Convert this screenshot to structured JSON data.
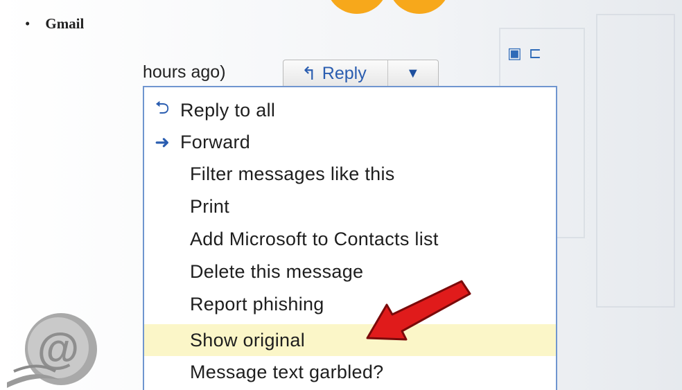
{
  "slide": {
    "bullet": "•",
    "heading": "Gmail"
  },
  "header": {
    "hours_text": "hours ago)",
    "reply_label": "Reply",
    "dropdown_glyph": "▼"
  },
  "menu": {
    "items": [
      {
        "label": "Reply to all",
        "icon": "reply-all-icon"
      },
      {
        "label": "Forward",
        "icon": "forward-arrow-icon"
      },
      {
        "label": "Filter messages like this"
      },
      {
        "label": "Print"
      },
      {
        "label": "Add Microsoft to Contacts list"
      },
      {
        "label": "Delete this message"
      },
      {
        "label": "Report phishing"
      },
      {
        "label": "Show original",
        "highlighted": true
      },
      {
        "label": "Message text garbled?"
      }
    ]
  },
  "colors": {
    "menu_border": "#6f95cf",
    "highlight": "#fbf6c8",
    "link_blue": "#2a5db0",
    "annotation_arrow": "#e01b1b"
  }
}
